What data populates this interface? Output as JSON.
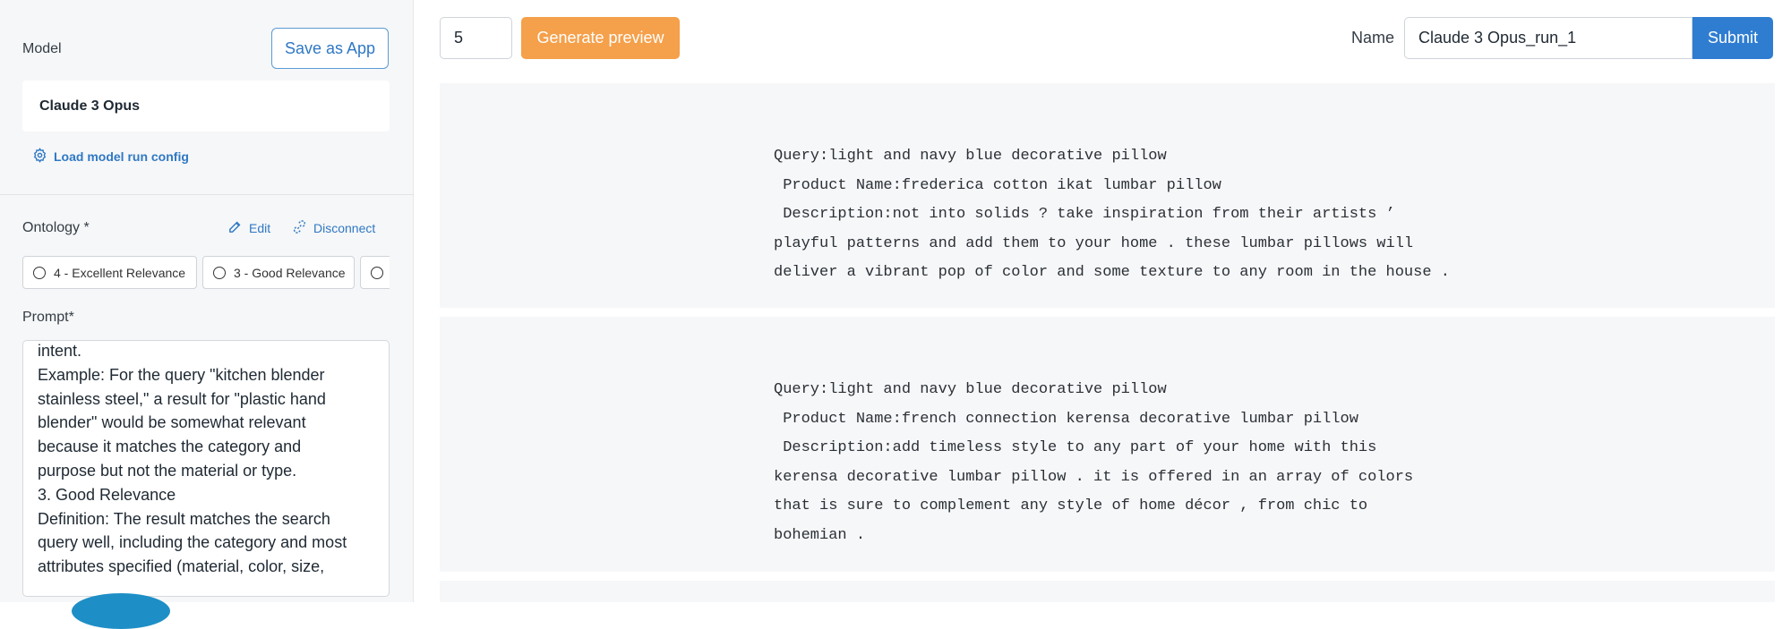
{
  "sidebar": {
    "model_label": "Model",
    "save_as_app": "Save as App",
    "model_value": "Claude 3 Opus",
    "load_config": "Load model run config",
    "ontology_label": "Ontology *",
    "edit": "Edit",
    "disconnect": "Disconnect",
    "chips": [
      "4 - Excellent Relevance",
      "3 - Good Relevance",
      ""
    ],
    "prompt_label": "Prompt*",
    "prompt_text": "intent.\nExample: For the query \"kitchen blender\nstainless steel,\" a result for \"plastic hand\nblender\" would be somewhat relevant\nbecause it matches the category and\npurpose but not the material or type.\n3. Good Relevance\nDefinition: The result matches the search\nquery well, including the category and most\nattributes specified (material, color, size,"
  },
  "toolbar": {
    "count_value": "5",
    "generate_preview": "Generate preview",
    "name_label": "Name",
    "name_value": "Claude 3 Opus_run_1",
    "submit": "Submit"
  },
  "preview": {
    "cards": [
      {
        "text": "Query:light and navy blue decorative pillow\n Product Name:frederica cotton ikat lumbar pillow\n Description:not into solids ? take inspiration from their artists ’\nplayful patterns and add them to your home . these lumbar pillows will\ndeliver a vibrant pop of color and some texture to any room in the house ."
      },
      {
        "text": "Query:light and navy blue decorative pillow\n Product Name:french connection kerensa decorative lumbar pillow\n Description:add timeless style to any part of your home with this\nkerensa decorative lumbar pillow . it is offered in an array of colors\nthat is sure to complement any style of home décor , from chic to\nbohemian ."
      }
    ]
  },
  "icons": {
    "settings": "gear-icon",
    "edit": "pencil-icon",
    "disconnect": "unlink-icon",
    "radio": "radio-icon"
  },
  "colors": {
    "accent_blue": "#2f7dd1",
    "generate_orange": "#f5a04a",
    "link_blue": "#2f78c4"
  }
}
